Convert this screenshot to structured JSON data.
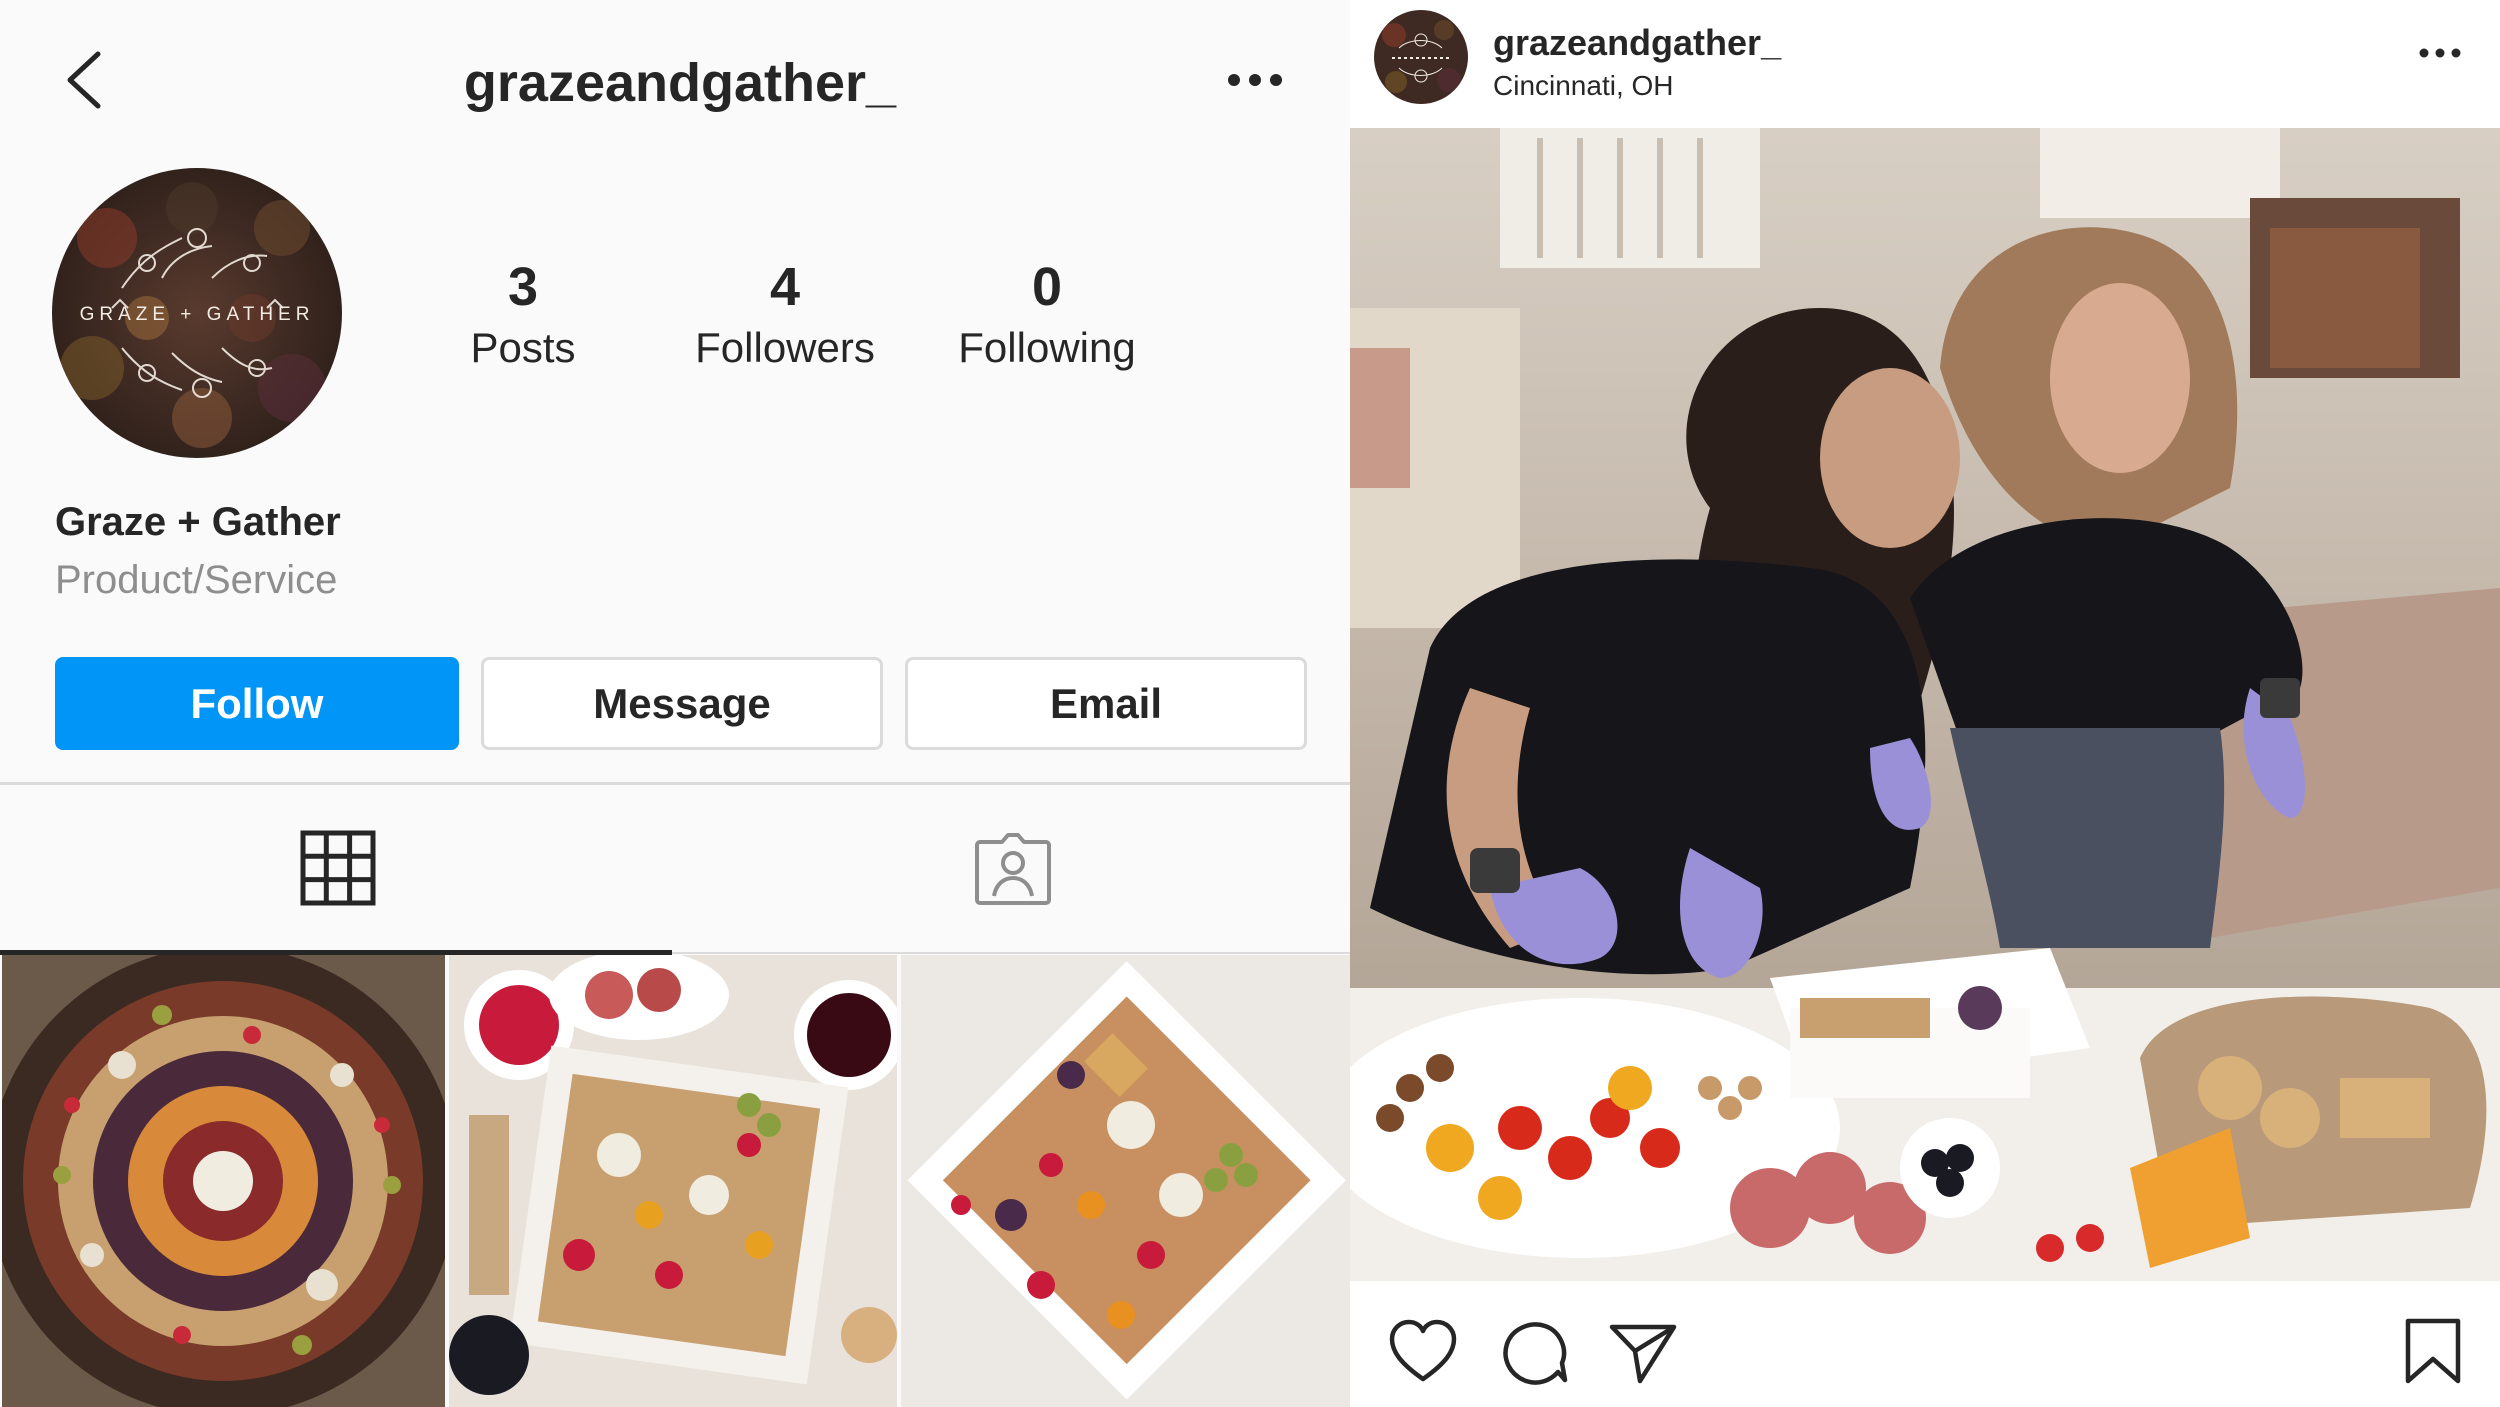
{
  "profile": {
    "handle": "grazeandgather_",
    "avatar_text": "GRAZE + GATHER",
    "stats": [
      {
        "value": "3",
        "label": "Posts"
      },
      {
        "value": "4",
        "label": "Followers"
      },
      {
        "value": "0",
        "label": "Following"
      }
    ],
    "display_name": "Graze + Gather",
    "category": "Product/Service",
    "buttons": {
      "follow": "Follow",
      "message": "Message",
      "email": "Email"
    },
    "tabs": {
      "grid_icon": "grid-icon",
      "tagged_icon": "tagged-person-icon",
      "active": "grid"
    },
    "icons": {
      "back": "chevron-left-icon",
      "more": "more-horizontal-icon"
    }
  },
  "post": {
    "username": "grazeandgather_",
    "location": "Cincinnati, OH",
    "icons": {
      "more": "more-horizontal-icon",
      "like": "heart-icon",
      "comment": "comment-bubble-icon",
      "share": "paper-plane-icon",
      "save": "bookmark-icon"
    }
  },
  "colors": {
    "accent": "#0095f6",
    "text": "#262626",
    "muted": "#8e8e8e",
    "border": "#dbdbdb",
    "background": "#fafafa"
  }
}
